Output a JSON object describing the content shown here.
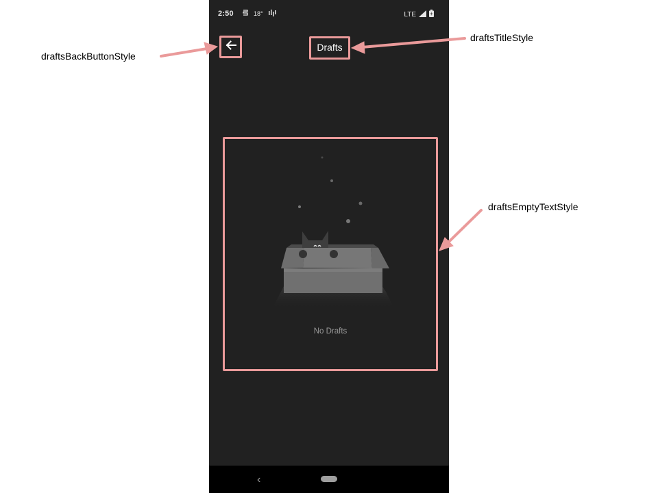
{
  "status_bar": {
    "time": "2:50",
    "temperature": "18°",
    "network": "LTE"
  },
  "toolbar": {
    "title": "Drafts",
    "back_icon": "arrow-back-icon"
  },
  "empty_state": {
    "text": "No Drafts",
    "illustration": "cat-in-box-illustration"
  },
  "nav_bar": {
    "back_glyph": "‹"
  },
  "annotations": {
    "back_button": "draftsBackButtonStyle",
    "title": "draftsTitleStyle",
    "empty_text": "draftsEmptyTextStyle"
  },
  "colors": {
    "background": "#212121",
    "annotation": "#ea9a9a",
    "nav_bar": "#000000"
  }
}
